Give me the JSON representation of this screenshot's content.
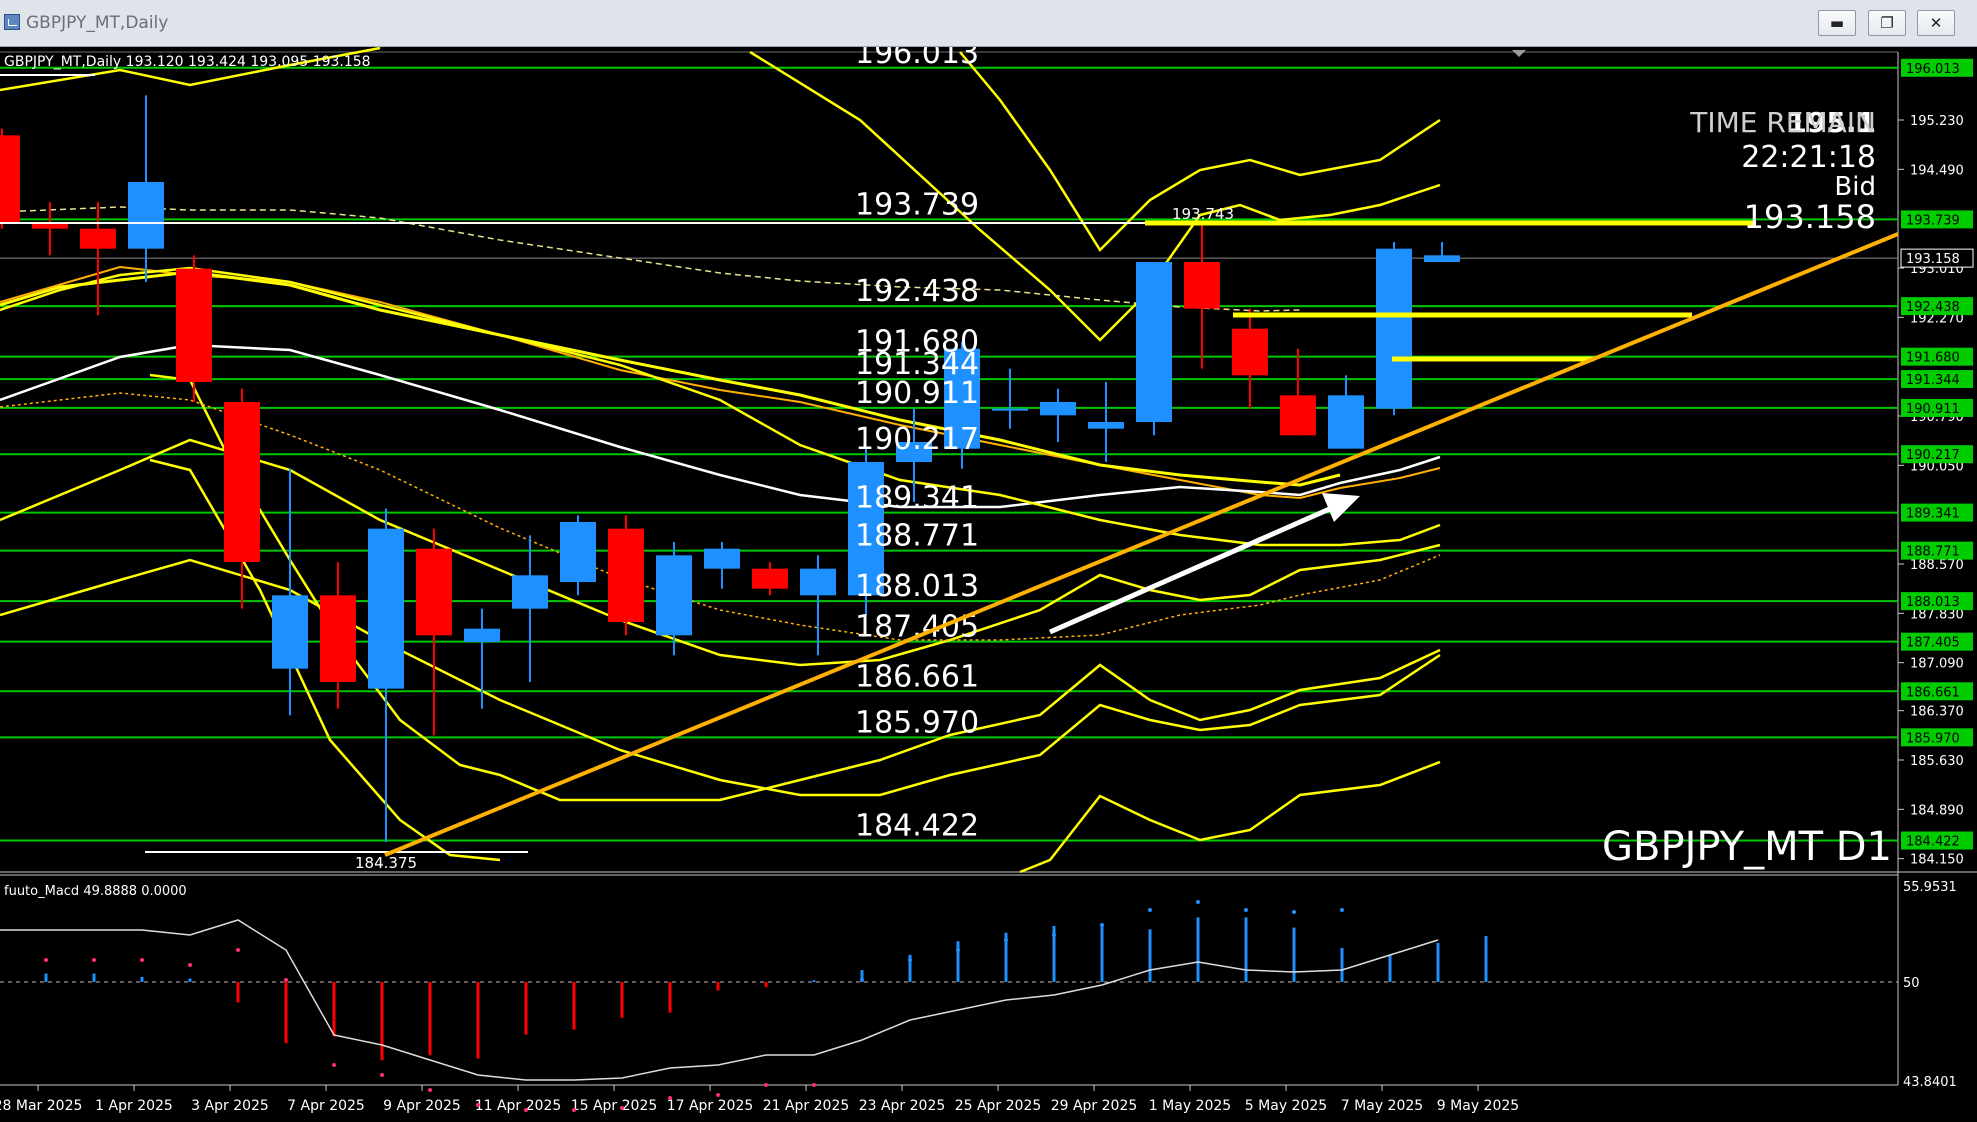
{
  "window": {
    "title": "GBPJPY_MT,Daily",
    "minimize_icon": "minimize-icon",
    "maximize_icon": "restore-icon",
    "close_icon": "close-icon"
  },
  "chart": {
    "info_line": "GBPJPY_MT,Daily  193.120 193.424 193.095 193.158",
    "symbol_label": "GBPJPY_MT D1",
    "time_remain_label": "TIME REMAIN",
    "time_remain_value": "22:21:18",
    "partial_price": "195.1",
    "bid_label": "Bid",
    "bid_value": "193.158",
    "high_marker": "193.743",
    "low_marker": "184.375"
  },
  "price_axis": [
    "195.230",
    "194.490",
    "193.010",
    "192.270",
    "190.790",
    "190.050",
    "188.570",
    "187.830",
    "187.090",
    "186.370",
    "185.630",
    "184.890",
    "184.150"
  ],
  "level_tags": [
    "196.013",
    "193.739",
    "193.158",
    "192.438",
    "191.680",
    "191.344",
    "190.911",
    "190.217",
    "189.341",
    "188.771",
    "188.013",
    "187.405",
    "186.661",
    "185.970",
    "184.422"
  ],
  "level_labels": [
    "196.013",
    "193.739",
    "192.438",
    "191.680",
    "191.344",
    "190.911",
    "190.217",
    "189.341",
    "188.771",
    "188.013",
    "187.405",
    "186.661",
    "185.970",
    "184.422"
  ],
  "date_axis": [
    "28 Mar 2025",
    "1 Apr 2025",
    "3 Apr 2025",
    "7 Apr 2025",
    "9 Apr 2025",
    "11 Apr 2025",
    "15 Apr 2025",
    "17 Apr 2025",
    "21 Apr 2025",
    "23 Apr 2025",
    "25 Apr 2025",
    "29 Apr 2025",
    "1 May 2025",
    "5 May 2025",
    "7 May 2025",
    "9 May 2025"
  ],
  "macd": {
    "title": "fuuto_Macd 49.8888  0.0000",
    "axis_top": "55.9531",
    "axis_mid": "50",
    "axis_bottom": "43.8401"
  },
  "colors": {
    "bull": "#1e90ff",
    "bear": "#ff0000",
    "level_line": "#00cc00",
    "band": "#ffff00",
    "trendline": "#ffb000",
    "arrow": "#ffffff"
  },
  "chart_data": {
    "type": "candlestick",
    "series": [
      {
        "o": 195.0,
        "h": 195.1,
        "l": 193.6,
        "c": 193.7
      },
      {
        "o": 193.7,
        "h": 194.0,
        "l": 193.2,
        "c": 193.6
      },
      {
        "o": 193.6,
        "h": 194.0,
        "l": 192.3,
        "c": 193.3
      },
      {
        "o": 193.3,
        "h": 195.6,
        "l": 192.8,
        "c": 194.3
      },
      {
        "o": 193.0,
        "h": 193.2,
        "l": 191.0,
        "c": 191.3
      },
      {
        "o": 191.0,
        "h": 191.2,
        "l": 187.9,
        "c": 188.6
      },
      {
        "o": 187.0,
        "h": 190.0,
        "l": 186.3,
        "c": 188.1
      },
      {
        "o": 188.1,
        "h": 188.6,
        "l": 186.4,
        "c": 186.8
      },
      {
        "o": 186.7,
        "h": 189.4,
        "l": 184.4,
        "c": 189.1
      },
      {
        "o": 188.8,
        "h": 189.1,
        "l": 186.0,
        "c": 187.5
      },
      {
        "o": 187.4,
        "h": 187.9,
        "l": 186.4,
        "c": 187.6
      },
      {
        "o": 187.9,
        "h": 189.0,
        "l": 186.8,
        "c": 188.4
      },
      {
        "o": 188.3,
        "h": 189.3,
        "l": 188.1,
        "c": 189.2
      },
      {
        "o": 189.1,
        "h": 189.3,
        "l": 187.5,
        "c": 187.7
      },
      {
        "o": 187.5,
        "h": 188.9,
        "l": 187.2,
        "c": 188.7
      },
      {
        "o": 188.5,
        "h": 188.9,
        "l": 188.2,
        "c": 188.8
      },
      {
        "o": 188.5,
        "h": 188.6,
        "l": 188.1,
        "c": 188.2
      },
      {
        "o": 188.1,
        "h": 188.7,
        "l": 187.2,
        "c": 188.5
      },
      {
        "o": 188.1,
        "h": 190.3,
        "l": 187.8,
        "c": 190.1
      },
      {
        "o": 190.1,
        "h": 190.9,
        "l": 189.5,
        "c": 190.4
      },
      {
        "o": 190.3,
        "h": 191.9,
        "l": 190.0,
        "c": 191.8
      },
      {
        "o": 190.9,
        "h": 191.5,
        "l": 190.6,
        "c": 190.9
      },
      {
        "o": 190.8,
        "h": 191.2,
        "l": 190.4,
        "c": 191.0
      },
      {
        "o": 190.6,
        "h": 191.3,
        "l": 190.1,
        "c": 190.7
      },
      {
        "o": 190.7,
        "h": 193.1,
        "l": 190.5,
        "c": 193.1
      },
      {
        "o": 193.1,
        "h": 193.7,
        "l": 191.5,
        "c": 192.4
      },
      {
        "o": 192.1,
        "h": 192.4,
        "l": 190.9,
        "c": 191.4
      },
      {
        "o": 191.1,
        "h": 191.8,
        "l": 190.5,
        "c": 190.5
      },
      {
        "o": 190.3,
        "h": 191.4,
        "l": 190.3,
        "c": 191.1
      },
      {
        "o": 190.9,
        "h": 193.4,
        "l": 190.8,
        "c": 193.3
      },
      {
        "o": 193.1,
        "h": 193.4,
        "l": 193.1,
        "c": 193.2
      }
    ],
    "ylim": [
      183.95,
      196.25
    ],
    "xlabels": [
      "28 Mar 2025",
      "1 Apr 2025",
      "3 Apr 2025",
      "7 Apr 2025",
      "9 Apr 2025",
      "11 Apr 2025",
      "15 Apr 2025",
      "17 Apr 2025",
      "21 Apr 2025",
      "23 Apr 2025",
      "25 Apr 2025",
      "29 Apr 2025",
      "1 May 2025",
      "5 May 2025",
      "7 May 2025",
      "9 May 2025"
    ]
  }
}
